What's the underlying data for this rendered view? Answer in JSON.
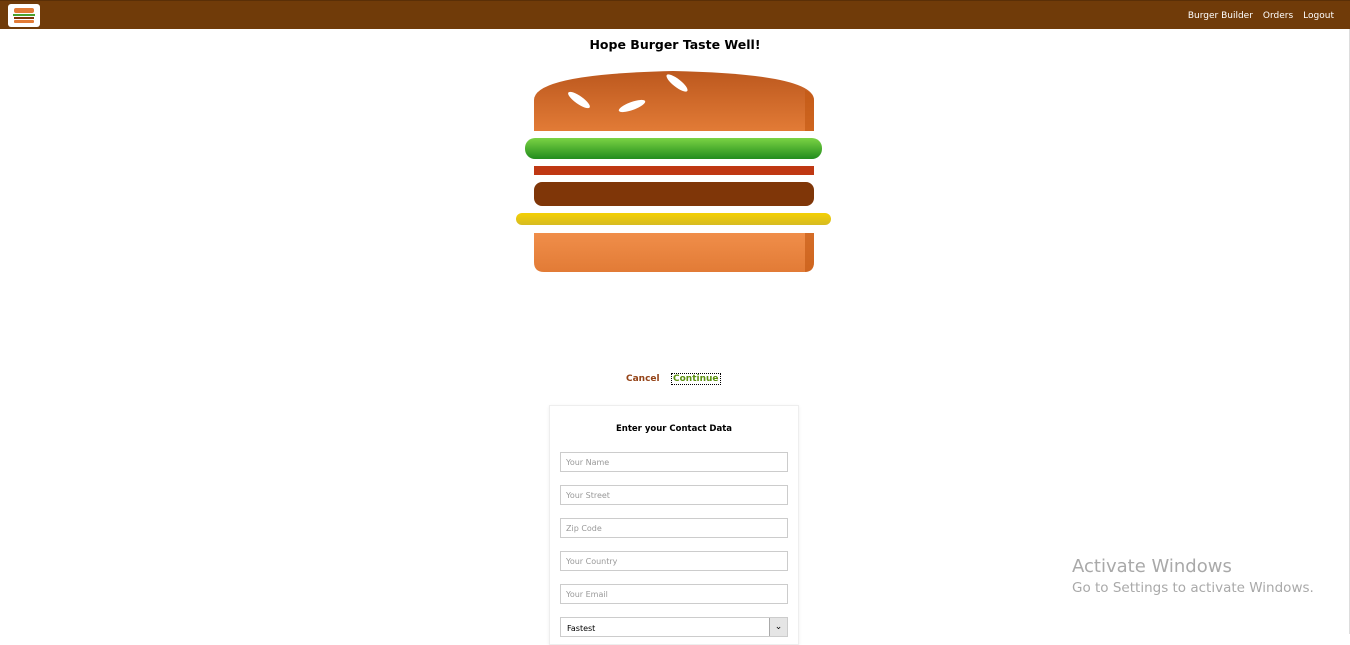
{
  "toolbar": {
    "logo_icon": "burger-logo-icon",
    "nav": [
      "Burger Builder",
      "Orders",
      "Logout"
    ]
  },
  "checkout": {
    "title": "Hope Burger Taste Well!",
    "cancel_label": "Cancel",
    "continue_label": "Continue"
  },
  "contact_form": {
    "heading": "Enter your Contact Data",
    "name_placeholder": "Your Name",
    "street_placeholder": "Your Street",
    "zip_placeholder": "Zip Code",
    "country_placeholder": "Your Country",
    "email_placeholder": "Your Email",
    "delivery_selected": "Fastest"
  },
  "watermark": {
    "line1": "Activate Windows",
    "line2": "Go to Settings to activate Windows."
  },
  "colors": {
    "toolbar": "#703b09",
    "bread": "#e27b36",
    "salad": "#4aa12c",
    "bacon": "#bf3813",
    "meat": "#7f3608",
    "cheese": "#e7c80f"
  }
}
